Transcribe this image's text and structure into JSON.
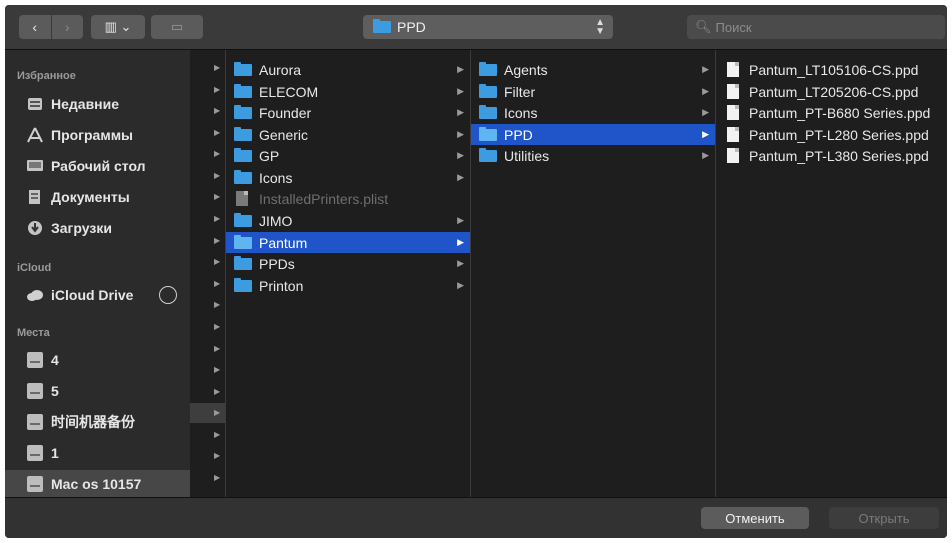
{
  "toolbar": {
    "back_glyph": "‹",
    "forward_glyph": "›",
    "view_glyph": "▥ ⌄",
    "action_glyph": "▭",
    "path_label": "PPD",
    "search_placeholder": "Поиск"
  },
  "sidebar": {
    "favorites_header": "Избранное",
    "favorites": [
      {
        "label": "Недавние",
        "icon": "recents-icon"
      },
      {
        "label": "Программы",
        "icon": "applications-icon"
      },
      {
        "label": "Рабочий стол",
        "icon": "desktop-icon"
      },
      {
        "label": "Документы",
        "icon": "documents-icon"
      },
      {
        "label": "Загрузки",
        "icon": "downloads-icon"
      }
    ],
    "icloud_header": "iCloud",
    "icloud_item": "iCloud Drive",
    "places_header": "Места",
    "places": [
      {
        "label": "4"
      },
      {
        "label": "5"
      },
      {
        "label": "时间机器备份"
      },
      {
        "label": "1"
      },
      {
        "label": "Mac os 10157",
        "selected": true
      }
    ]
  },
  "columns": {
    "col1": [
      {
        "label": "Aurora",
        "kind": "folder"
      },
      {
        "label": "ELECOM",
        "kind": "folder"
      },
      {
        "label": "Founder",
        "kind": "folder"
      },
      {
        "label": "Generic",
        "kind": "folder"
      },
      {
        "label": "GP",
        "kind": "folder"
      },
      {
        "label": "Icons",
        "kind": "folder"
      },
      {
        "label": "InstalledPrinters.plist",
        "kind": "file-dim"
      },
      {
        "label": "JIMO",
        "kind": "folder"
      },
      {
        "label": "Pantum",
        "kind": "folder",
        "selected": true
      },
      {
        "label": "PPDs",
        "kind": "folder"
      },
      {
        "label": "Printon",
        "kind": "folder"
      }
    ],
    "col2": [
      {
        "label": "Agents",
        "kind": "folder"
      },
      {
        "label": "Filter",
        "kind": "folder"
      },
      {
        "label": "Icons",
        "kind": "folder"
      },
      {
        "label": "PPD",
        "kind": "folder",
        "selected": true
      },
      {
        "label": "Utilities",
        "kind": "folder"
      }
    ],
    "col3": [
      {
        "label": "Pantum_LT105106-CS.ppd",
        "kind": "file"
      },
      {
        "label": "Pantum_LT205206-CS.ppd",
        "kind": "file"
      },
      {
        "label": "Pantum_PT-B680 Series.ppd",
        "kind": "file"
      },
      {
        "label": "Pantum_PT-L280 Series.ppd",
        "kind": "file"
      },
      {
        "label": "Pantum_PT-L380 Series.ppd",
        "kind": "file"
      }
    ]
  },
  "footer": {
    "cancel_label": "Отменить",
    "open_label": "Открыть"
  },
  "colors": {
    "selection": "#1f55c8",
    "folder": "#3d9be0",
    "background": "#1e1e1e",
    "sidebar": "#2b2b2b"
  }
}
